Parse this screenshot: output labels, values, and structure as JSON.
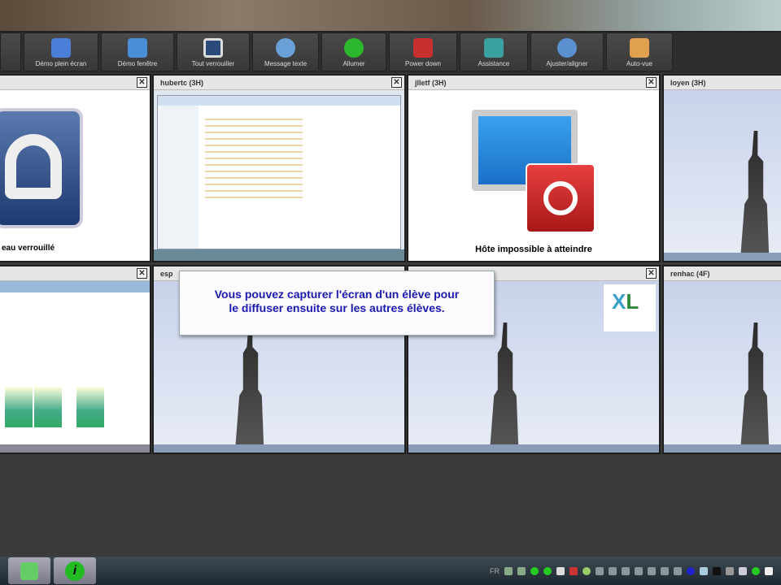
{
  "toolbar": {
    "buttons": [
      {
        "label": "",
        "icon": "menu-icon",
        "color": "#555"
      },
      {
        "label": "Démo plein écran",
        "icon": "demo-fullscreen-icon",
        "color": "#4a7ed8"
      },
      {
        "label": "Démo fenêtre",
        "icon": "demo-window-icon",
        "color": "#4a8ed8"
      },
      {
        "label": "Tout verrouiller",
        "icon": "lock-icon",
        "color": "#2a4a7a"
      },
      {
        "label": "Message texte",
        "icon": "message-icon",
        "color": "#6aa0d8"
      },
      {
        "label": "Allumer",
        "icon": "power-on-icon",
        "color": "#2cb82c"
      },
      {
        "label": "Power down",
        "icon": "power-down-icon",
        "color": "#c83030"
      },
      {
        "label": "Assistance",
        "icon": "assistance-icon",
        "color": "#3aa0a0"
      },
      {
        "label": "Ajuster/aligner",
        "icon": "magnifier-icon",
        "color": "#5a90d0"
      },
      {
        "label": "Auto-vue",
        "icon": "auto-view-icon",
        "color": "#e0a050"
      }
    ]
  },
  "tiles": {
    "r1c1": {
      "title": "",
      "caption": "eau verrouillé"
    },
    "r1c2": {
      "title": "hubertc (3H)"
    },
    "r1c3": {
      "title": "jlletf (3H)",
      "caption": "Hôte impossible à atteindre"
    },
    "r1c4": {
      "title": "loyen (3H)"
    },
    "r2c1": {
      "title": ""
    },
    "r2c2": {
      "title": "esp"
    },
    "r2c3": {
      "title": ""
    },
    "r2c4": {
      "title": "renhac (4F)"
    }
  },
  "tooltip": {
    "line1": "Vous pouvez capturer l'écran d'un élève pour",
    "line2": "le diffuser ensuite sur les autres élèves."
  },
  "taskbar": {
    "lang": "FR"
  }
}
